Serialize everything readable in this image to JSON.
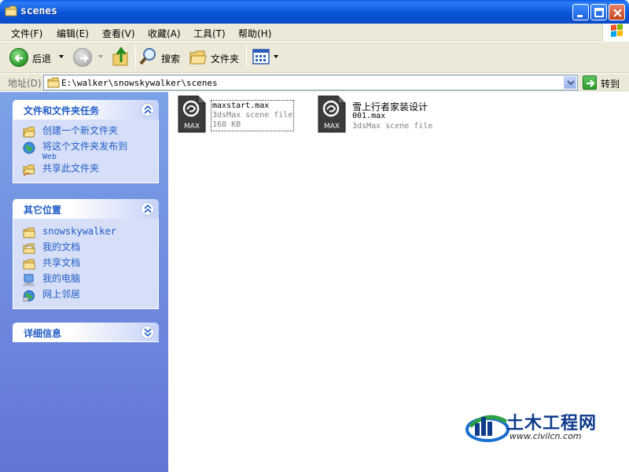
{
  "window": {
    "title": "scenes"
  },
  "menu": [
    {
      "label": "文件(F)"
    },
    {
      "label": "编辑(E)"
    },
    {
      "label": "查看(V)"
    },
    {
      "label": "收藏(A)"
    },
    {
      "label": "工具(T)"
    },
    {
      "label": "帮助(H)"
    }
  ],
  "toolbar": {
    "back_label": "后退",
    "search_label": "搜索",
    "folders_label": "文件夹"
  },
  "address": {
    "label": "地址(D)",
    "path": "E:\\walker\\snowskywalker\\scenes",
    "go_label": "转到"
  },
  "taskpane": {
    "file_tasks": {
      "title": "文件和文件夹任务",
      "items": [
        {
          "label": "创建一个新文件夹",
          "icon": "new-folder-icon"
        },
        {
          "label": "将这个文件夹发布到",
          "sub": "Web",
          "icon": "publish-web-icon"
        },
        {
          "label": "共享此文件夹",
          "icon": "share-folder-icon"
        }
      ]
    },
    "other_places": {
      "title": "其它位置",
      "items": [
        {
          "label": "snowskywalker",
          "icon": "folder-icon"
        },
        {
          "label": "我的文档",
          "icon": "my-documents-icon"
        },
        {
          "label": "共享文档",
          "icon": "shared-documents-icon"
        },
        {
          "label": "我的电脑",
          "icon": "my-computer-icon"
        },
        {
          "label": "网上邻居",
          "icon": "network-places-icon"
        }
      ]
    },
    "details": {
      "title": "详细信息"
    }
  },
  "files": [
    {
      "name": "maxstart.max",
      "type": "3dsMax scene file",
      "size": "168 KB",
      "icon_badge": "MAX"
    },
    {
      "name_line1": "雪上行者家装设计",
      "name_line2": "001.max",
      "type": "3dsMax scene file",
      "icon_badge": "MAX"
    }
  ],
  "watermark": {
    "text": "土木工程网",
    "url": "www.civilcn.com"
  }
}
